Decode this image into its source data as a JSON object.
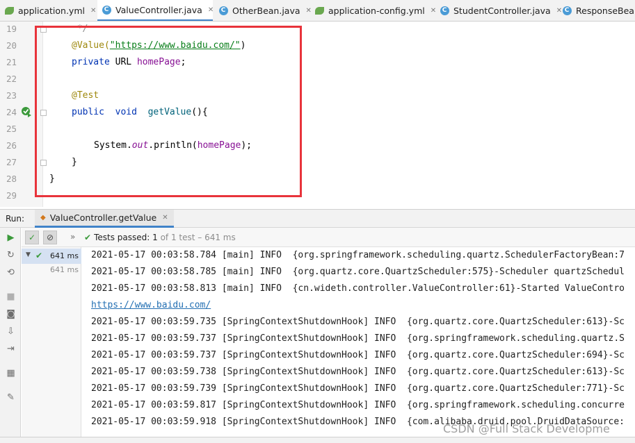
{
  "tabs": [
    {
      "label": "application.yml",
      "icon": "yml-file-icon",
      "active": false
    },
    {
      "label": "ValueController.java",
      "icon": "java-class-icon",
      "active": true
    },
    {
      "label": "OtherBean.java",
      "icon": "java-class-icon",
      "active": false
    },
    {
      "label": "application-config.yml",
      "icon": "yml-file-icon",
      "active": false
    },
    {
      "label": "StudentController.java",
      "icon": "java-class-icon",
      "active": false
    },
    {
      "label": "ResponseBean",
      "icon": "java-class-icon",
      "active": false
    }
  ],
  "editor": {
    "line_numbers": [
      "19",
      "20",
      "21",
      "22",
      "23",
      "24",
      "25",
      "26",
      "27",
      "28",
      "29"
    ],
    "lines": {
      "l19": "*/",
      "l20_annotation": "@Value(",
      "l20_string": "\"https://www.baidu.com/\"",
      "l20_close": ")",
      "l21_kw": "private",
      "l21_type": " URL ",
      "l21_field": "homePage",
      "l21_end": ";",
      "l23_annotation": "@Test",
      "l24_kw1": "public",
      "l24_kw2": "void",
      "l24_method": "getValue",
      "l24_end": "(){",
      "l26_system": "System.",
      "l26_out": "out",
      "l26_println": ".println(",
      "l26_field": "homePage",
      "l26_end": ");",
      "l27": "}",
      "l28": "}"
    }
  },
  "run_panel": {
    "label": "Run:",
    "tab_label": "ValueController.getValue",
    "tests_passed": "Tests passed:",
    "tests_count": "1",
    "tests_suffix": "of 1 test – 641 ms",
    "tree": {
      "root_time": "641 ms",
      "child_time": "641 ms"
    },
    "console_lines": [
      "2021-05-17 00:03:58.784 [main] INFO  {org.springframework.scheduling.quartz.SchedulerFactoryBean:7",
      "2021-05-17 00:03:58.785 [main] INFO  {org.quartz.core.QuartzScheduler:575}-Scheduler quartzSchedul",
      "2021-05-17 00:03:58.813 [main] INFO  {cn.wideth.controller.ValueController:61}-Started ValueContro",
      "https://www.baidu.com/",
      "2021-05-17 00:03:59.735 [SpringContextShutdownHook] INFO  {org.quartz.core.QuartzScheduler:613}-Sc",
      "2021-05-17 00:03:59.737 [SpringContextShutdownHook] INFO  {org.springframework.scheduling.quartz.S",
      "2021-05-17 00:03:59.737 [SpringContextShutdownHook] INFO  {org.quartz.core.QuartzScheduler:694}-Sc",
      "2021-05-17 00:03:59.738 [SpringContextShutdownHook] INFO  {org.quartz.core.QuartzScheduler:613}-Sc",
      "2021-05-17 00:03:59.739 [SpringContextShutdownHook] INFO  {org.quartz.core.QuartzScheduler:771}-Sc",
      "2021-05-17 00:03:59.817 [SpringContextShutdownHook] INFO  {org.springframework.scheduling.concurre",
      "2021-05-17 00:03:59.918 [SpringContextShutdownHook] INFO  {com.alibaba.druid.pool.DruidDataSource:"
    ]
  },
  "watermark": "CSDN @Full Stack Developme",
  "colors": {
    "highlight_box": "#e8333b",
    "active_tab_underline": "#4083c9",
    "annotation": "#9e880d",
    "keyword": "#0033b3",
    "field": "#871094",
    "string": "#067d17",
    "link": "#2470b3",
    "pass_green": "#3b9a3b"
  }
}
